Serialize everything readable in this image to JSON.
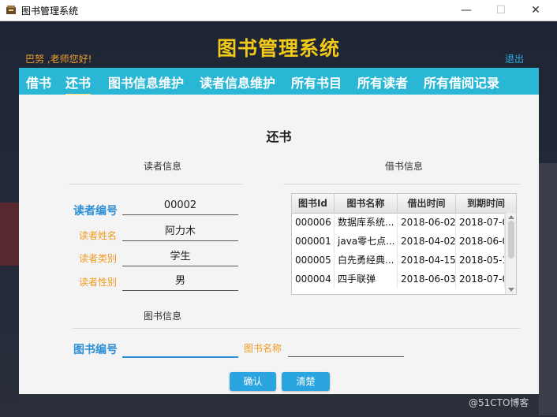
{
  "window": {
    "title": "图书管理系统",
    "minimize": "—",
    "maximize": "☐",
    "close": "✕"
  },
  "header": {
    "app_title": "图书管理系统",
    "greeting": "巴努 ,老师您好!",
    "logout": "退出"
  },
  "nav": {
    "items": [
      "借书",
      "还书",
      "图书信息维护",
      "读者信息维护",
      "所有书目",
      "所有读者",
      "所有借阅记录"
    ],
    "active": "还书"
  },
  "page": {
    "heading": "还书"
  },
  "reader_section": {
    "label": "读者信息",
    "id_label": "读者编号",
    "id_value": "00002",
    "name_label": "读者姓名",
    "name_value": "阿力木",
    "type_label": "读者类别",
    "type_value": "学生",
    "gender_label": "读者性别",
    "gender_value": "男"
  },
  "borrow_section": {
    "label": "借书信息",
    "columns": [
      "图书Id",
      "图书名称",
      "借出时间",
      "到期时间"
    ],
    "rows": [
      [
        "000006",
        "数据库系统...",
        "2018-06-02",
        "2018-07-0"
      ],
      [
        "000001",
        "java零七点...",
        "2018-04-02",
        "2018-06-0"
      ],
      [
        "000005",
        "白先勇经典...",
        "2018-04-15",
        "2018-05-1"
      ],
      [
        "000004",
        "四手联弹",
        "2018-06-03",
        "2018-07-0"
      ]
    ]
  },
  "book_section": {
    "label": "图书信息",
    "book_id_label": "图书编号",
    "book_id_value": "",
    "book_name_label": "图书名称",
    "book_name_value": ""
  },
  "buttons": {
    "confirm": "确认",
    "clear": "清楚"
  },
  "watermark": "@51CTO博客",
  "colors": {
    "nav_bg": "#2ab7d5",
    "title_yellow": "#f2c919",
    "accent_blue": "#2d8fd8",
    "label_orange": "#f09a20",
    "button_blue": "#2aa5e0"
  }
}
